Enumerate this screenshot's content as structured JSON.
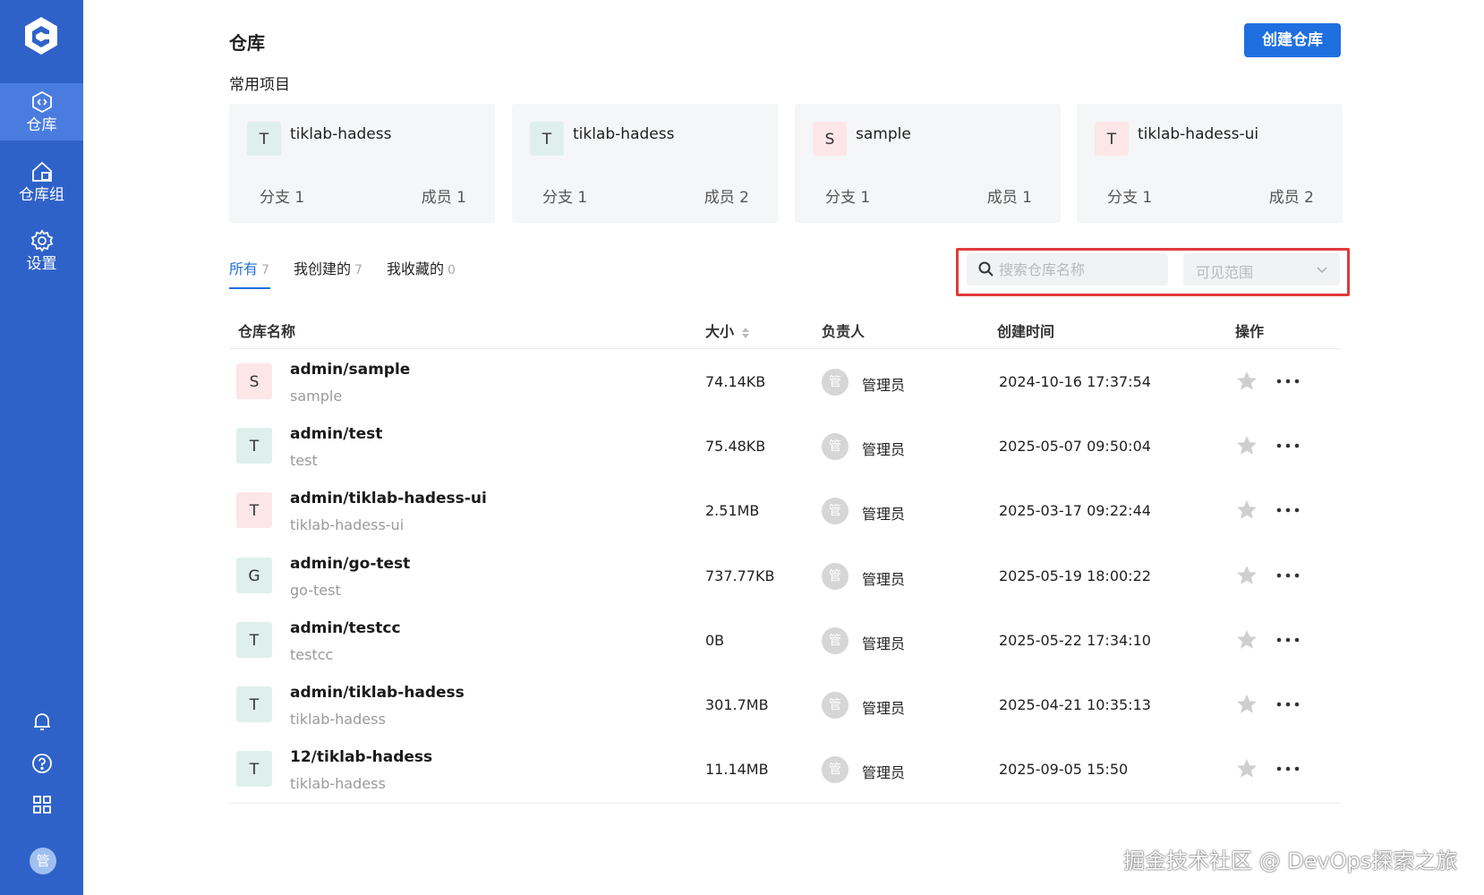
{
  "sidebar": {
    "items": [
      {
        "label": "仓库",
        "icon": "repo-icon",
        "active": true
      },
      {
        "label": "仓库组",
        "icon": "repo-group-icon",
        "active": false
      },
      {
        "label": "设置",
        "icon": "gear-icon",
        "active": false
      }
    ],
    "bottom_icons": [
      "bell-icon",
      "help-icon",
      "apps-grid-icon"
    ],
    "avatar_text": "管"
  },
  "header": {
    "title": "仓库",
    "create_button": "创建仓库"
  },
  "recent": {
    "label": "常用项目",
    "cards": [
      {
        "avatar": "T",
        "name": "tiklab-hadess",
        "branch_label": "分支",
        "branch": "1",
        "member_label": "成员",
        "member": "1",
        "avatar_color": "green"
      },
      {
        "avatar": "T",
        "name": "tiklab-hadess",
        "branch_label": "分支",
        "branch": "1",
        "member_label": "成员",
        "member": "2",
        "avatar_color": "green"
      },
      {
        "avatar": "S",
        "name": "sample",
        "branch_label": "分支",
        "branch": "1",
        "member_label": "成员",
        "member": "1",
        "avatar_color": "pink"
      },
      {
        "avatar": "T",
        "name": "tiklab-hadess-ui",
        "branch_label": "分支",
        "branch": "1",
        "member_label": "成员",
        "member": "2",
        "avatar_color": "pink"
      }
    ]
  },
  "tabs": [
    {
      "label": "所有",
      "count": "7"
    },
    {
      "label": "我创建的",
      "count": "7"
    },
    {
      "label": "我收藏的",
      "count": "0"
    }
  ],
  "filters": {
    "search_placeholder": "搜索仓库名称",
    "search_value": "",
    "scope_placeholder": "可见范围"
  },
  "table": {
    "headers": {
      "name": "仓库名称",
      "size": "大小",
      "owner": "负责人",
      "created": "创建时间",
      "actions": "操作"
    },
    "rows": [
      {
        "avatar": "S",
        "avatar_color": "pink",
        "name": "admin/sample",
        "sub": "sample",
        "size": "74.14KB",
        "owner_avatar": "管",
        "owner": "管理员",
        "created": "2024-10-16 17:37:54"
      },
      {
        "avatar": "T",
        "avatar_color": "green",
        "name": "admin/test",
        "sub": "test",
        "size": "75.48KB",
        "owner_avatar": "管",
        "owner": "管理员",
        "created": "2025-05-07 09:50:04"
      },
      {
        "avatar": "T",
        "avatar_color": "pink",
        "name": "admin/tiklab-hadess-ui",
        "sub": "tiklab-hadess-ui",
        "size": "2.51MB",
        "owner_avatar": "管",
        "owner": "管理员",
        "created": "2025-03-17 09:22:44"
      },
      {
        "avatar": "G",
        "avatar_color": "green",
        "name": "admin/go-test",
        "sub": "go-test",
        "size": "737.77KB",
        "owner_avatar": "管",
        "owner": "管理员",
        "created": "2025-05-19 18:00:22"
      },
      {
        "avatar": "T",
        "avatar_color": "green",
        "name": "admin/testcc",
        "sub": "testcc",
        "size": "0B",
        "owner_avatar": "管",
        "owner": "管理员",
        "created": "2025-05-22 17:34:10"
      },
      {
        "avatar": "T",
        "avatar_color": "green",
        "name": "admin/tiklab-hadess",
        "sub": "tiklab-hadess",
        "size": "301.7MB",
        "owner_avatar": "管",
        "owner": "管理员",
        "created": "2025-04-21 10:35:13"
      },
      {
        "avatar": "T",
        "avatar_color": "green",
        "name": "12/tiklab-hadess",
        "sub": "tiklab-hadess",
        "size": "11.14MB",
        "owner_avatar": "管",
        "owner": "管理员",
        "created": "2025-09-05 15:50"
      }
    ]
  },
  "watermark": "掘金技术社区 @ DevOps探索之旅",
  "colors": {
    "sidebar": "#2f62c9",
    "sidebar_active": "#4a7ce0",
    "primary": "#1f6fe0",
    "highlight_box": "#e03a3a"
  }
}
